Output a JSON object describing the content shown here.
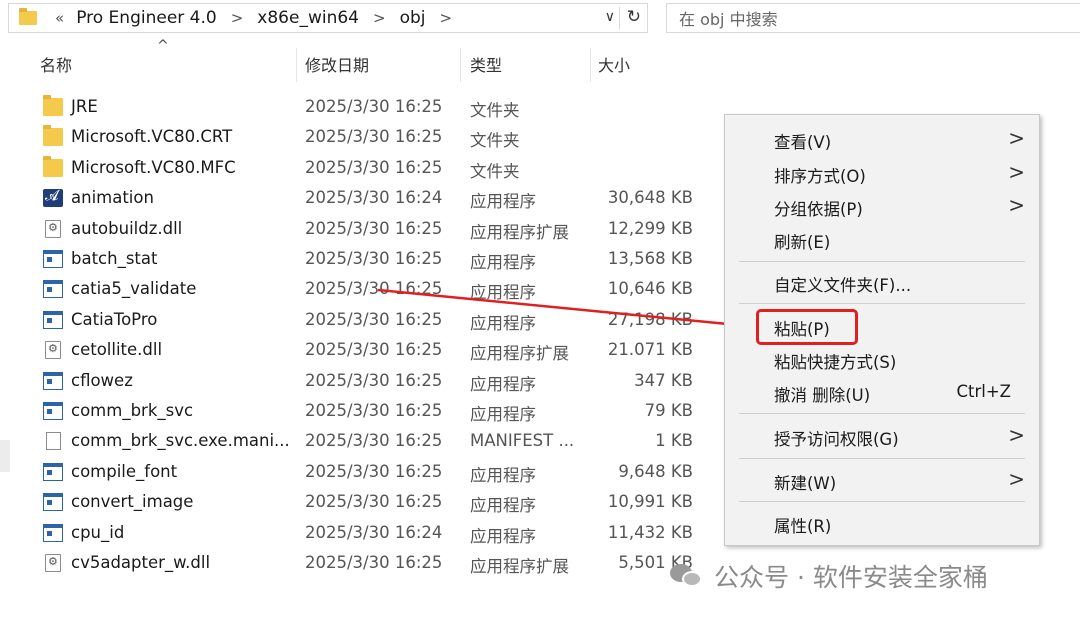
{
  "address": {
    "lead": "«",
    "crumbs": [
      "Pro Engineer 4.0",
      "x86e_win64",
      "obj"
    ],
    "separator": ">",
    "dropdown": "∨",
    "refresh": "↻"
  },
  "search": {
    "placeholder": "在 obj 中搜索"
  },
  "columns": {
    "name": "名称",
    "date": "修改日期",
    "type": "类型",
    "size": "大小",
    "sort_indicator": "^"
  },
  "files": [
    {
      "name": "JRE",
      "date": "2025/3/30 16:25",
      "type": "文件夹",
      "size": "",
      "icon": "folder"
    },
    {
      "name": "Microsoft.VC80.CRT",
      "date": "2025/3/30 16:25",
      "type": "文件夹",
      "size": "",
      "icon": "folder"
    },
    {
      "name": "Microsoft.VC80.MFC",
      "date": "2025/3/30 16:25",
      "type": "文件夹",
      "size": "",
      "icon": "folder"
    },
    {
      "name": "animation",
      "date": "2025/3/30 16:24",
      "type": "应用程序",
      "size": "30,648 KB",
      "icon": "anim"
    },
    {
      "name": "autobuildz.dll",
      "date": "2025/3/30 16:25",
      "type": "应用程序扩展",
      "size": "12,299 KB",
      "icon": "dll"
    },
    {
      "name": "batch_stat",
      "date": "2025/3/30 16:25",
      "type": "应用程序",
      "size": "13,568 KB",
      "icon": "app"
    },
    {
      "name": "catia5_validate",
      "date": "2025/3/30 16:25",
      "type": "应用程序",
      "size": "10,646 KB",
      "icon": "app"
    },
    {
      "name": "CatiaToPro",
      "date": "2025/3/30 16:25",
      "type": "应用程序",
      "size": "27,198 KB",
      "icon": "app"
    },
    {
      "name": "cetollite.dll",
      "date": "2025/3/30 16:25",
      "type": "应用程序扩展",
      "size": "21.071 KB",
      "icon": "dll"
    },
    {
      "name": "cflowez",
      "date": "2025/3/30 16:25",
      "type": "应用程序",
      "size": "347 KB",
      "icon": "app"
    },
    {
      "name": "comm_brk_svc",
      "date": "2025/3/30 16:25",
      "type": "应用程序",
      "size": "79 KB",
      "icon": "app"
    },
    {
      "name": "comm_brk_svc.exe.mani...",
      "date": "2025/3/30 16:25",
      "type": "MANIFEST ...",
      "size": "1 KB",
      "icon": "file"
    },
    {
      "name": "compile_font",
      "date": "2025/3/30 16:25",
      "type": "应用程序",
      "size": "9,648 KB",
      "icon": "app"
    },
    {
      "name": "convert_image",
      "date": "2025/3/30 16:25",
      "type": "应用程序",
      "size": "10,991 KB",
      "icon": "app"
    },
    {
      "name": "cpu_id",
      "date": "2025/3/30 16:24",
      "type": "应用程序",
      "size": "11,432 KB",
      "icon": "app"
    },
    {
      "name": "cv5adapter_w.dll",
      "date": "2025/3/30 16:25",
      "type": "应用程序扩展",
      "size": "5,501 KB",
      "icon": "dll"
    }
  ],
  "context_menu": {
    "view": "查看(V)",
    "sort": "排序方式(O)",
    "group": "分组依据(P)",
    "refresh": "刷新(E)",
    "customize": "自定义文件夹(F)...",
    "paste": "粘贴(P)",
    "paste_shortcut": "粘贴快捷方式(S)",
    "undo": "撤消 删除(U)",
    "undo_shortcut": "Ctrl+Z",
    "grant_access": "授予访问权限(G)",
    "new": "新建(W)",
    "properties": "属性(R)",
    "submenu_arrow": ">"
  },
  "watermark": "公众号 · 软件安装全家桶",
  "colors": {
    "highlight": "#e02020",
    "arrow": "#e02020",
    "folder": "#f5c94b",
    "app_icon": "#2d63a8"
  }
}
